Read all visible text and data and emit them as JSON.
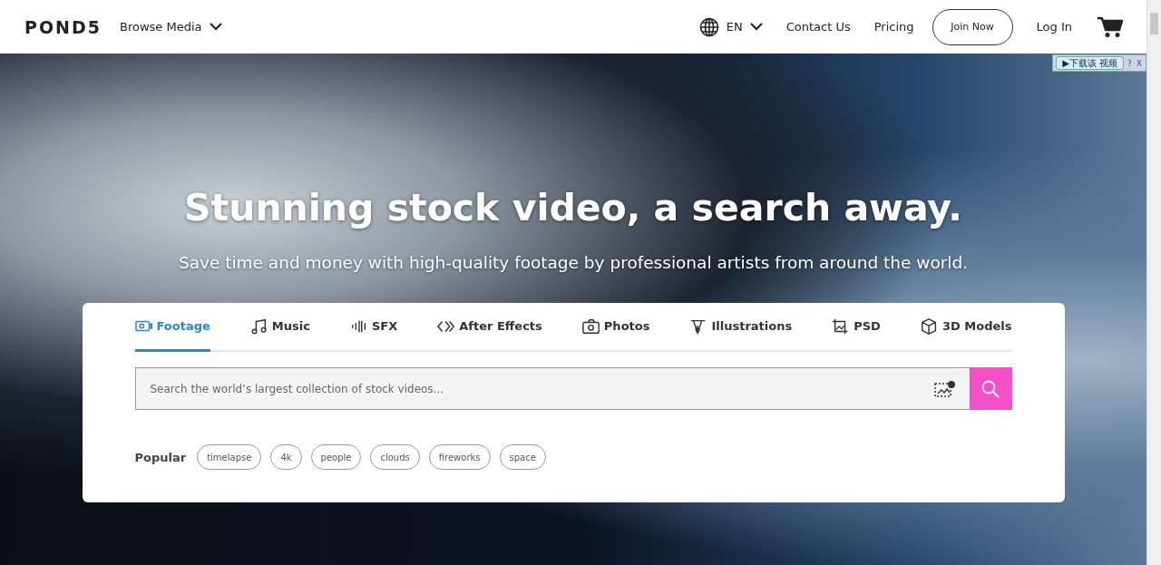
{
  "header": {
    "logo": "POND5",
    "browse_menu": "Browse Media",
    "language": "EN",
    "links": [
      "Contact Us",
      "Pricing"
    ],
    "join_button": "Join Now",
    "login": "Log In"
  },
  "download_plugin": {
    "label": "▶下载该 视频",
    "help": "?",
    "close": "X"
  },
  "hero": {
    "title": "Stunning stock video, a search away.",
    "subtitle": "Save time and money with high-quality footage by professional artists from around the world."
  },
  "search_card": {
    "tabs": [
      {
        "label": "Footage",
        "kind": "footage",
        "selected": true
      },
      {
        "label": "Music",
        "kind": "music",
        "selected": false
      },
      {
        "label": "SFX",
        "kind": "sfx",
        "selected": false
      },
      {
        "label": "After Effects",
        "kind": "effects",
        "selected": false
      },
      {
        "label": "Photos",
        "kind": "photos",
        "selected": false
      },
      {
        "label": "Illustrations",
        "kind": "illustrations",
        "selected": false
      },
      {
        "label": "PSD",
        "kind": "psd",
        "selected": false
      },
      {
        "label": "3D Models",
        "kind": "models",
        "selected": false
      }
    ],
    "search": {
      "placeholder": "Search the world’s largest collection of stock videos..."
    },
    "popular": {
      "label": "Popular",
      "tags": [
        "timelapse",
        "4k",
        "people",
        "clouds",
        "fireworks",
        "space"
      ]
    }
  }
}
